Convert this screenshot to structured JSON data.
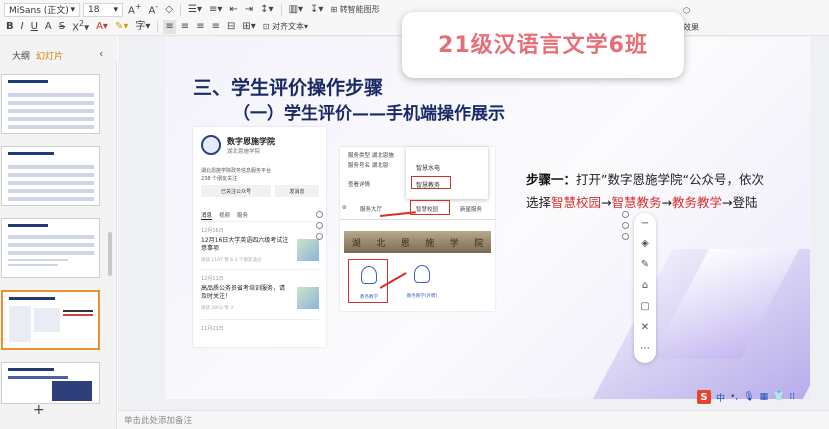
{
  "toolbar": {
    "font_name": "MiSans (正文)",
    "font_size": "18",
    "convert_smartart": "转智能图形",
    "align_text": "对齐文本",
    "suffix_label": "效果"
  },
  "panel": {
    "tab_outline": "大纲",
    "tab_slides": "幻灯片",
    "slide_numbers": [
      "",
      "",
      "",
      "",
      "",
      "",
      ""
    ],
    "add_label": "+"
  },
  "banner": {
    "text": "21级汉语言文学6班"
  },
  "slide": {
    "title": "三、学生评价操作步骤",
    "subtitle": "（一）学生评价——手机端操作展示",
    "step_label": "步骤一：",
    "step_plain_1": "打开”数字恩施学院“公众号，依次选择",
    "step_hl_1": "智慧校园",
    "step_arrow_1": "→",
    "step_hl_2": "智慧教务",
    "step_arrow_2": "→",
    "step_hl_3": "教务教学",
    "step_plain_2": "→登陆",
    "shot1": {
      "name": "数字恩施学院",
      "school": "湖北恩施学院",
      "desc": "湖北恩施学院政务信息服务平台",
      "fans": "238 个朋友关注",
      "btn_follow": "已关注公众号",
      "btn_msg": "发消息",
      "tab_msg": "消息",
      "tab_video": "视频",
      "tab_service": "服务",
      "date1": "12月16日",
      "article1": "12月16日大学英语四六级考试注意事项",
      "meta1": "阅读 1197  赞 6  3 个朋友读过",
      "date2": "12月11日",
      "article2": "高品质公务员省考培训服务，请及时关注！",
      "meta2": "阅读 2852  赞 3",
      "date3": "11月21日"
    },
    "shot2": {
      "row1": "服务类型  湖北恩施",
      "row2": "服务号名  湖北恩",
      "row3": "查看详情",
      "menu_water": "智慧水电",
      "menu_teach": "智慧教务",
      "svc_label": "服务大厅",
      "campus": "智慧校园",
      "newsvc": "新星服务",
      "banner": [
        "湖",
        "北",
        "恩",
        "施",
        "学",
        "院"
      ],
      "card1": "教务教学",
      "card2": "教务教学(外聘)"
    }
  },
  "ime": {
    "logo": "S",
    "mode": "中"
  },
  "notes": {
    "placeholder": "单击此处添加备注"
  }
}
